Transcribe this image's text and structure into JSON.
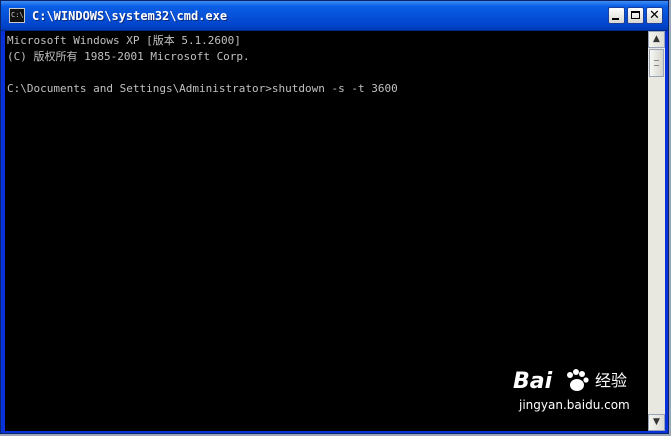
{
  "window": {
    "title": "C:\\WINDOWS\\system32\\cmd.exe",
    "icon": "cmd-icon",
    "icon_text": "C:\\",
    "buttons": {
      "minimize": "minimize-icon",
      "maximize": "maximize-icon",
      "close": "close-icon",
      "close_glyph": "✕"
    }
  },
  "console": {
    "lines": [
      "Microsoft Windows XP [版本 5.1.2600]",
      "(C) 版权所有 1985-2001 Microsoft Corp.",
      "C:\\Documents and Settings\\Administrator>shutdown -s -t 3600"
    ],
    "text_color": "#c0c0c0",
    "background": "#000000"
  },
  "scrollbar": {
    "up_glyph": "▲",
    "down_glyph": "▼"
  },
  "watermark": {
    "brand": "Bai",
    "brand_suffix": "经验",
    "url": "jingyan.baidu.com"
  },
  "colors": {
    "titlebar": "#0650d6",
    "console_bg": "#000000",
    "console_text": "#c0c0c0"
  }
}
